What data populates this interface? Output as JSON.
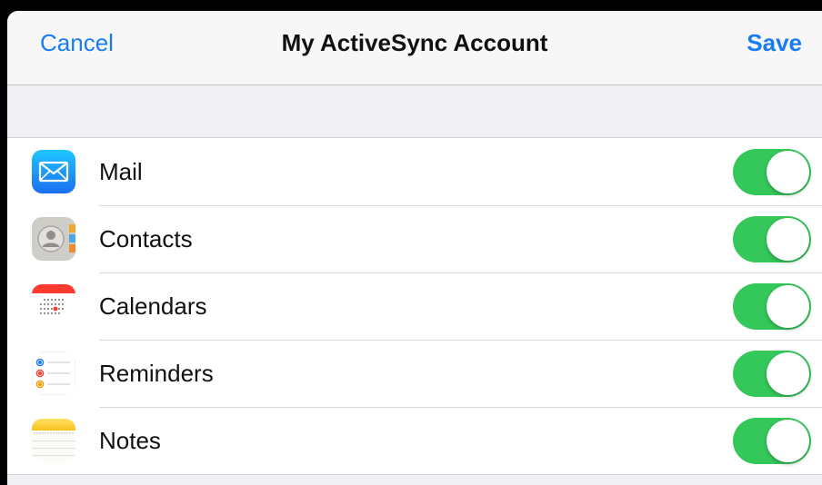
{
  "navbar": {
    "cancel_label": "Cancel",
    "title": "My ActiveSync Account",
    "save_label": "Save"
  },
  "colors": {
    "accent": "#1a7cf3",
    "toggle_on": "#34c759",
    "background": "#efeff4"
  },
  "services": [
    {
      "label": "Mail",
      "icon": "mail-icon",
      "enabled": true
    },
    {
      "label": "Contacts",
      "icon": "contacts-icon",
      "enabled": true
    },
    {
      "label": "Calendars",
      "icon": "calendars-icon",
      "enabled": true
    },
    {
      "label": "Reminders",
      "icon": "reminders-icon",
      "enabled": true
    },
    {
      "label": "Notes",
      "icon": "notes-icon",
      "enabled": true
    }
  ]
}
